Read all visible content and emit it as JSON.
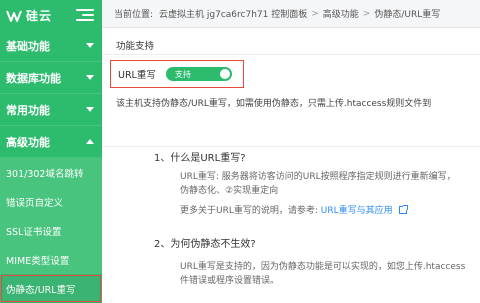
{
  "app": {
    "logo_text": "硅云"
  },
  "sidebar": {
    "items": [
      {
        "label": "基础功能"
      },
      {
        "label": "数据库功能"
      },
      {
        "label": "常用功能"
      },
      {
        "label": "高级功能"
      }
    ],
    "sub_items": [
      {
        "label": "301/302域名跳转"
      },
      {
        "label": "错误页自定义"
      },
      {
        "label": "SSL证书设置"
      },
      {
        "label": "MIME类型设置"
      },
      {
        "label": "伪静态/URL重写"
      }
    ]
  },
  "breadcrumb": {
    "prefix": "当前位置:",
    "items": [
      "云虚拟主机 jg7ca6rc7h71 控制面板",
      "高级功能",
      "伪静态/URL重写"
    ],
    "separator": ">"
  },
  "content": {
    "section_title": "功能支持",
    "feature_label": "URL重写",
    "toggle_label": "支持",
    "support_note": "该主机支持伪静态/URL重写，如需使用伪静态，只需上传.htaccess规则文件到",
    "faq": {
      "q1": "1、什么是URL重写?",
      "a1_line1": "URL重写: 服务器将访客访问的URL按照程序指定规则进行重新编写，",
      "a1_line2": "伪静态化、②实现重定向",
      "more_prefix": "更多关于URL重写的说明，请参考:",
      "more_link": "URL重写与其应用",
      "q2": "2、为何伪静态不生效?",
      "a2_line1": "URL重写是支持的，因为伪静态功能是可以实现的，如您上传.htaccess",
      "a2_line2": "件错误或程序设置错误。"
    }
  },
  "colors": {
    "brand_green": "#2dbb6e",
    "highlight_red": "#e8483b",
    "link_blue": "#2d8cf0"
  }
}
